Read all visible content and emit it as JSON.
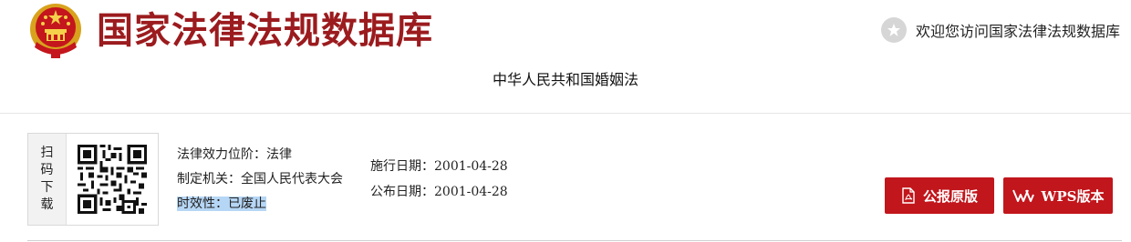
{
  "header": {
    "site_title": "国家法律法规数据库",
    "welcome_text": "欢迎您访问国家法律法规数据库",
    "welcome_icon": "star-icon",
    "brand_color": "#9b1b1e"
  },
  "law": {
    "title": "中华人民共和国婚姻法"
  },
  "scan": {
    "label_chars": [
      "扫",
      "码",
      "下",
      "载"
    ],
    "qr_icon": "qr-code-icon"
  },
  "meta": {
    "level_label": "法律效力位阶：",
    "level_value": "法律",
    "authority_label": "制定机关：",
    "authority_value": "全国人民代表大会",
    "status_label": "时效性：",
    "status_value": "已废止",
    "effective_label": "施行日期：",
    "effective_value": "2001-04-28",
    "publish_label": "公布日期：",
    "publish_value": "2001-04-28"
  },
  "actions": {
    "gazette_label": "公报原版",
    "gazette_icon": "pdf-icon",
    "wps_label": "WPS版本",
    "wps_icon": "wps-icon",
    "button_color": "#c1161c"
  }
}
